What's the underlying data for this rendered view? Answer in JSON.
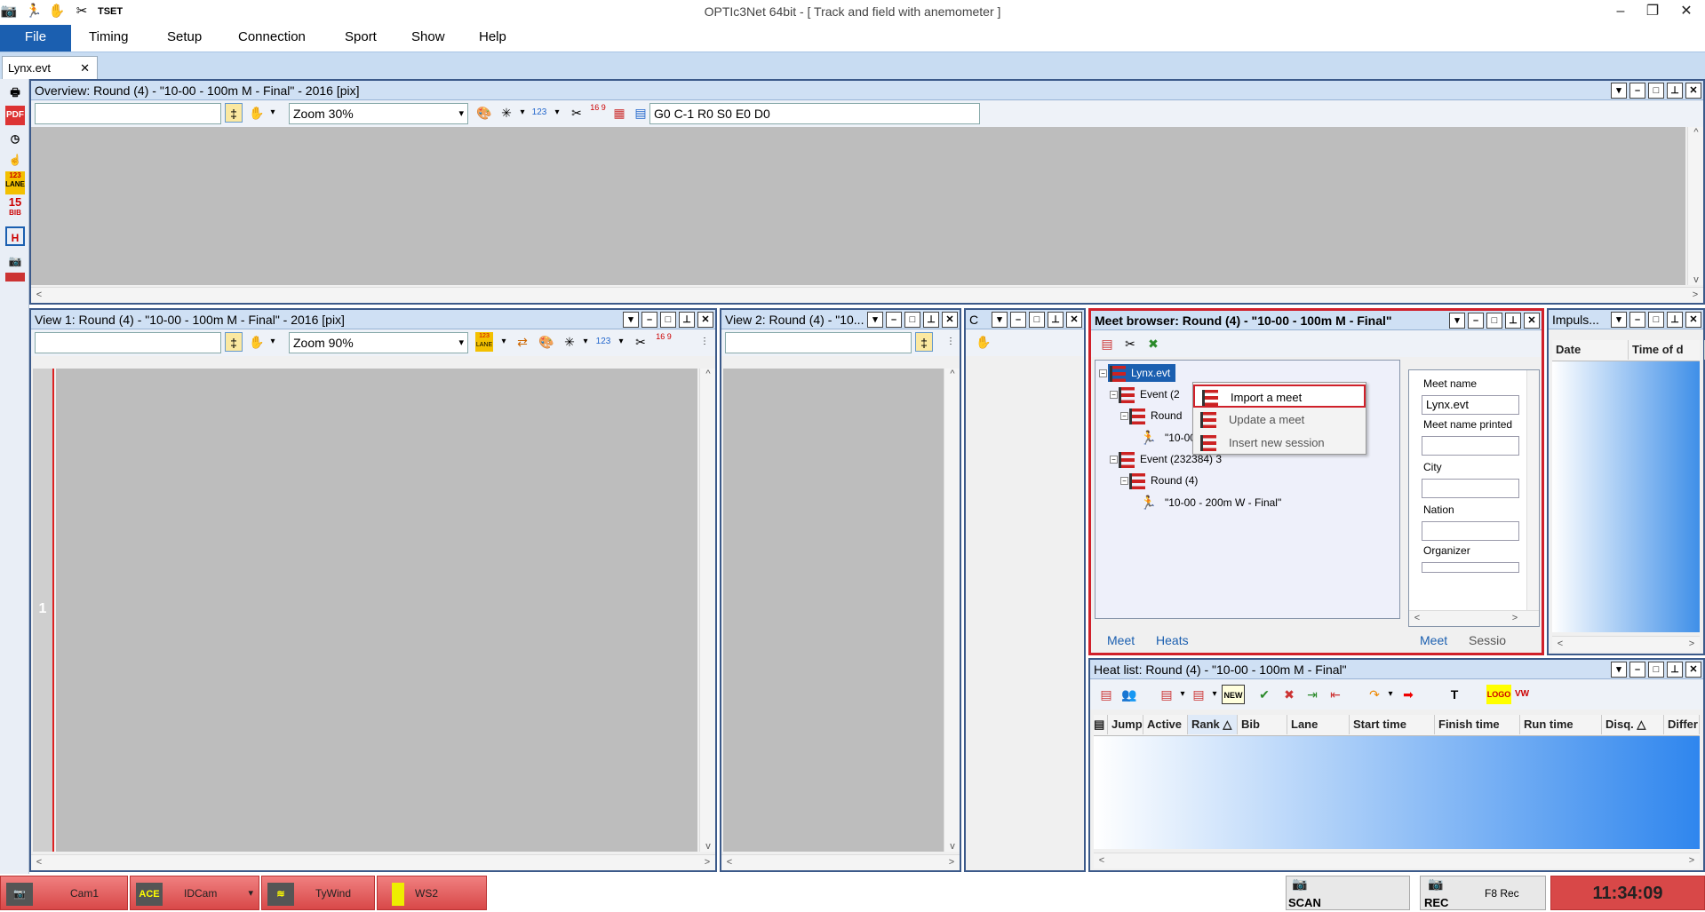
{
  "app": {
    "title": "OPTIc3Net 64bit - [ Track and field with anemometer ]",
    "quick_access": [
      "camera-icon",
      "runner-icon",
      "hand-icon",
      "tools-icon",
      "tset-icon"
    ],
    "tset_label": "TSET"
  },
  "menu": [
    "File",
    "Timing",
    "Setup",
    "Connection",
    "Sport",
    "Show",
    "Help"
  ],
  "doc_tab": {
    "label": "Lynx.evt",
    "close": "✕"
  },
  "left_toolbar": {
    "lane_label": "LANE",
    "bib_number": "15",
    "bib_label": "BIB"
  },
  "overview": {
    "title": "Overview: Round (4) - \"10-00 - 100m M - Final\" - 2016 [pix]",
    "zoom": "Zoom 30%",
    "status_field": "G0 C-1 R0 S0 E0 D0",
    "num_123": "123",
    "num_16_9": "16 9"
  },
  "view1": {
    "title": "View 1: Round (4) - \"10-00 - 100m M - Final\" - 2016 [pix]",
    "zoom": "Zoom 90%",
    "lane_number": "1",
    "lane_label": "LANE",
    "num_123": "123",
    "num_16_9": "16 9"
  },
  "view2": {
    "title": "View 2: Round (4) - \"10..."
  },
  "small_panel": {
    "title": "C"
  },
  "meet_browser": {
    "title": "Meet browser: Round (4) - \"10-00 - 100m M - Final\"",
    "tree": {
      "root": "Lynx.evt",
      "event1": "Event (2",
      "round1": "Round",
      "heat1": "\"10-00 - 100m M - Final\"",
      "event2": "Event (232384) 3",
      "round2": "Round (4)",
      "heat2": "\"10-00 - 200m W - Final\""
    },
    "context_menu": [
      "Import a meet",
      "Update a meet",
      "Insert new session"
    ],
    "fields": {
      "meet_name_label": "Meet name",
      "meet_name_value": "Lynx.evt",
      "meet_name_printed_label": "Meet name printed",
      "city_label": "City",
      "nation_label": "Nation",
      "organizer_label": "Organizer"
    },
    "tree_tabs": [
      "Meet",
      "Heats"
    ],
    "form_tabs": [
      "Meet",
      "Sessio"
    ]
  },
  "impulse": {
    "title": "Impuls...",
    "columns": [
      "Date",
      "Time of d"
    ]
  },
  "heat_list": {
    "title": "Heat list: Round (4) - \"10-00 - 100m M - Final\"",
    "new_label": "NEW",
    "logo_label": "LOGO",
    "vw_label": "VW",
    "columns": [
      "Jump",
      "Active",
      "Rank",
      "Bib",
      "Lane",
      "Start time",
      "Finish time",
      "Run time",
      "Disq.",
      "Differ"
    ]
  },
  "statusbar": {
    "buttons": [
      {
        "label": "Cam1",
        "icon": "camera-icon"
      },
      {
        "label": "IDCam",
        "icon": "idcam-icon",
        "badge": "ACE"
      },
      {
        "label": "TyWind",
        "icon": "wind-icon"
      },
      {
        "label": "WS2",
        "icon": "sensor-icon"
      }
    ],
    "scan": "SCAN",
    "rec": "REC",
    "f8": "F8 Rec",
    "clock": "11:34:09"
  },
  "colors": {
    "accent": "#1b5fb0",
    "highlight_border": "#d0202a",
    "status_red": "#d84848",
    "panel_header": "#cfe0f4"
  }
}
